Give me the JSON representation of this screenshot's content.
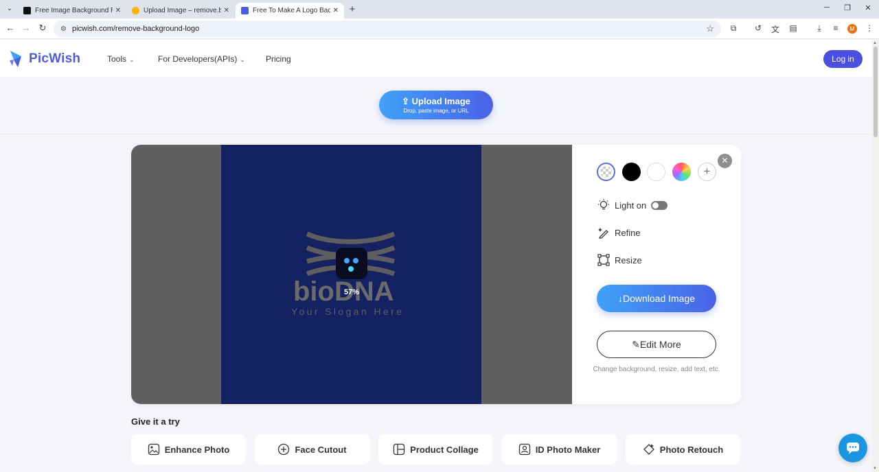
{
  "browser": {
    "tabs": [
      {
        "title": "Free Image Background Remo",
        "active": false,
        "favicon_color": "#111111"
      },
      {
        "title": "Upload Image – remove.bg",
        "active": false,
        "favicon_color": "#f5b400"
      },
      {
        "title": "Free To Make A Logo Backgro",
        "active": true,
        "favicon_color": "#4b5ce0"
      }
    ],
    "url": "picwish.com/remove-background-logo",
    "profile_initial": "M"
  },
  "header": {
    "brand": "PicWish",
    "nav": [
      {
        "label": "Tools",
        "has_dropdown": true
      },
      {
        "label": "For Developers(APIs)",
        "has_dropdown": true
      },
      {
        "label": "Pricing",
        "has_dropdown": false
      }
    ],
    "login_label": "Log in"
  },
  "upload": {
    "label": "Upload Image",
    "hint": "Drop, paste image, or URL"
  },
  "editor": {
    "progress_text": "57%",
    "progress_value": 57,
    "image_text": {
      "brand": "bioDNA",
      "slogan": "Your Slogan Here"
    },
    "background_options": [
      "transparent",
      "black",
      "white",
      "color-picker",
      "add"
    ],
    "selected_background": "transparent",
    "options": {
      "light_label": "Light on",
      "light_enabled": false,
      "refine_label": "Refine",
      "resize_label": "Resize"
    },
    "download_label": "Download Image",
    "edit_more_label": "Edit More",
    "edit_more_hint": "Change background, resize, add text, etc."
  },
  "try_section": {
    "title": "Give it a try",
    "items": [
      {
        "label": "Enhance Photo",
        "icon": "enhance-photo-icon"
      },
      {
        "label": "Face Cutout",
        "icon": "face-cutout-icon"
      },
      {
        "label": "Product Collage",
        "icon": "collage-icon"
      },
      {
        "label": "ID Photo Maker",
        "icon": "id-photo-icon"
      },
      {
        "label": "Photo Retouch",
        "icon": "retouch-icon"
      }
    ]
  },
  "colors": {
    "brand": "#4b5ce0",
    "login_bg": "#4b4fe0",
    "canvas_bg": "#606060",
    "image_bg": "#152262",
    "gradient_start": "#3fa2f7",
    "gradient_end": "#4a62e8",
    "chat_bg": "#1b95e0"
  }
}
